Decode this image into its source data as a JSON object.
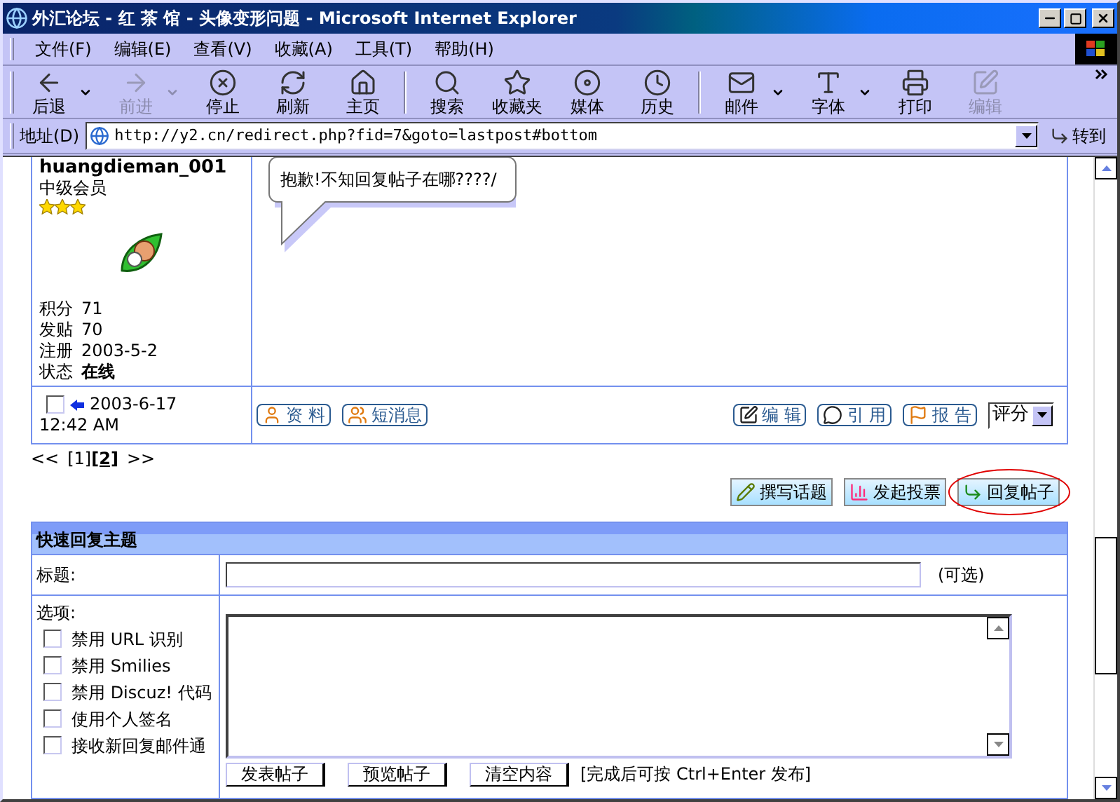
{
  "window": {
    "title": "外汇论坛 - 红 茶 馆 - 头像变形问题 - Microsoft Internet Explorer"
  },
  "menu": [
    "文件(F)",
    "编辑(E)",
    "查看(V)",
    "收藏(A)",
    "工具(T)",
    "帮助(H)"
  ],
  "toolbar_groups": [
    {
      "buttons": [
        {
          "label": "后退",
          "disabled": false,
          "dropdown": true
        },
        {
          "label": "前进",
          "disabled": true,
          "dropdown": true
        },
        {
          "label": "停止",
          "disabled": false,
          "dropdown": false
        },
        {
          "label": "刷新",
          "disabled": false,
          "dropdown": false
        },
        {
          "label": "主页",
          "disabled": false,
          "dropdown": false
        }
      ]
    },
    {
      "buttons": [
        {
          "label": "搜索",
          "disabled": false,
          "dropdown": false
        },
        {
          "label": "收藏夹",
          "disabled": false,
          "dropdown": false
        },
        {
          "label": "媒体",
          "disabled": false,
          "dropdown": false
        },
        {
          "label": "历史",
          "disabled": false,
          "dropdown": false
        }
      ]
    },
    {
      "buttons": [
        {
          "label": "邮件",
          "disabled": false,
          "dropdown": true
        },
        {
          "label": "字体",
          "disabled": false,
          "dropdown": true
        },
        {
          "label": "打印",
          "disabled": false,
          "dropdown": false
        },
        {
          "label": "编辑",
          "disabled": true,
          "dropdown": false
        }
      ]
    }
  ],
  "address": {
    "label": "地址(D)",
    "url": "http://y2.cn/redirect.php?fid=7&goto=lastpost#bottom",
    "go": "转到"
  },
  "post": {
    "author": "huangdieman_001",
    "rank": "中级会员",
    "stars": 3,
    "stats": [
      {
        "label": "积分",
        "value": "71",
        "bold": false
      },
      {
        "label": "发贴",
        "value": "70",
        "bold": false
      },
      {
        "label": "注册",
        "value": "2003-5-2",
        "bold": false
      },
      {
        "label": "状态",
        "value": "在线",
        "bold": true
      }
    ],
    "message": "抱歉!不知回复帖子在哪????/",
    "checked": false,
    "date": "2003-6-17",
    "time": "12:42 AM",
    "left_actions": [
      "资 料",
      "短消息"
    ],
    "right_actions": [
      "编 辑",
      "引 用",
      "报 告"
    ],
    "rate_select": "评分"
  },
  "pagination": {
    "prev": "<<",
    "pages": [
      {
        "label": "[1]",
        "selected": false
      },
      {
        "label": "[2]",
        "selected": true
      }
    ],
    "next": ">>"
  },
  "actions": [
    {
      "label": "撰写话题",
      "circled": false
    },
    {
      "label": "发起投票",
      "circled": false
    },
    {
      "label": "回复帖子",
      "circled": true
    }
  ],
  "quick_reply": {
    "title": "快速回复主题",
    "subject_label": "标题:",
    "subject_hint": "(可选)",
    "options_label": "选项:",
    "options": [
      {
        "label": "禁用 URL 识别",
        "checked": false
      },
      {
        "label": "禁用 Smilies",
        "checked": false
      },
      {
        "label": "禁用 Discuz! 代码",
        "checked": false
      },
      {
        "label": "使用个人签名",
        "checked": false
      },
      {
        "label": "接收新回复邮件通",
        "checked": false
      }
    ],
    "buttons": [
      "发表帖子",
      "预览帖子",
      "清空内容"
    ],
    "tip": "[完成后可按 Ctrl+Enter 发布]"
  }
}
